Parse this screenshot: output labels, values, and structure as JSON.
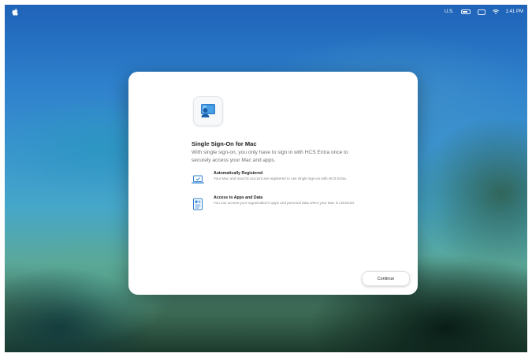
{
  "menubar": {
    "apple_icon": "apple-icon",
    "keyboard_layout": "U.S.",
    "time": "1:41 PM"
  },
  "dialog": {
    "app_icon": "company-portal-icon",
    "title": "Single Sign-On for Mac",
    "subtitle": "With single sign-on, you only have to sign in with HCS Entra once to securely access your Mac and apps.",
    "features": [
      {
        "icon": "laptop-registered-icon",
        "title": "Automatically Registered",
        "description": "Your Mac and macOS account are registered to use single sign-on with HCS Entra."
      },
      {
        "icon": "apps-data-icon",
        "title": "Access to Apps and Data",
        "description": "You can access your organization's apps and personal data when your Mac is unlocked."
      }
    ],
    "continue_label": "Continue"
  },
  "colors": {
    "dialog_bg": "#ffffff",
    "accent_blue": "#2f7fd0",
    "desktop_top": "#1f63b8"
  }
}
